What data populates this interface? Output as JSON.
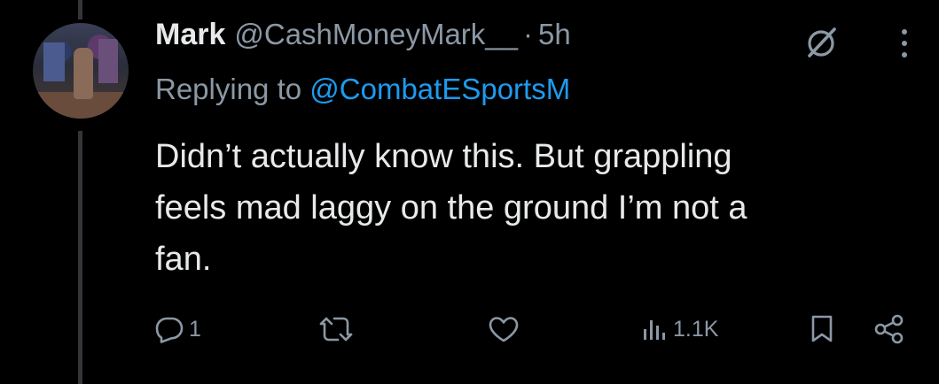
{
  "tweet": {
    "display_name": "Mark",
    "handle": "@CashMoneyMark__",
    "separator": "·",
    "time": "5h",
    "replying_prefix": "Replying to",
    "replying_to": "@CombatESportsM",
    "text_lines": [
      "Didn’t actually know this. But grappling",
      "feels mad laggy on the ground I’m not a",
      "fan."
    ]
  },
  "actions": {
    "reply_count": "1",
    "views_count": "1.1K"
  },
  "icons": {
    "grok": "grok-icon",
    "more": "more-icon",
    "reply": "reply-icon",
    "retweet": "retweet-icon",
    "like": "heart-icon",
    "views": "views-icon",
    "bookmark": "bookmark-icon",
    "share": "share-icon"
  },
  "colors": {
    "background": "#000000",
    "text": "#e7e9ea",
    "muted": "#8b98a5",
    "link": "#1d9bf0",
    "thread_line": "#333639"
  }
}
